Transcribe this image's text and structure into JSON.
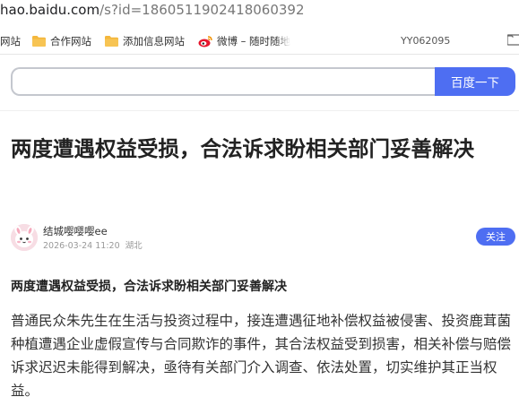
{
  "browser": {
    "address_host": "hao.baidu.com",
    "address_path": "/s?id=1860511902418060392"
  },
  "bookmarks": {
    "items": [
      {
        "label": "网站",
        "icon": "none"
      },
      {
        "label": "合作网站",
        "icon": "folder-icon"
      },
      {
        "label": "添加信息网站",
        "icon": "folder-icon"
      },
      {
        "label": "微博 – 随时随地",
        "icon": "weibo-icon"
      }
    ],
    "user": "YY062095"
  },
  "search": {
    "value": "",
    "button_label": "百度一下"
  },
  "article": {
    "title": "两度遭遇权益受损，合法诉求盼相关部门妥善解决",
    "author": {
      "name": "结城嘤嘤嘤ee",
      "date": "2026-03-24 11:20",
      "location": "湖北",
      "follow_label": "关注"
    },
    "subtitle": "两度遭遇权益受损，合法诉求盼相关部门妥善解决",
    "body": "普通民众朱先生在生活与投资过程中，接连遭遇征地补偿权益被侵害、投资鹿茸菌种植遭遇企业虚假宣传与合同欺诈的事件，其合法权益受到损害，相关补偿与赔偿诉求迟迟未能得到解决，亟待有关部门介入调查、依法处置，切实维护其正当权益。"
  },
  "colors": {
    "accent": "#4e6ef2",
    "folder": "#f4b73c",
    "weibo": "#e6162d"
  }
}
